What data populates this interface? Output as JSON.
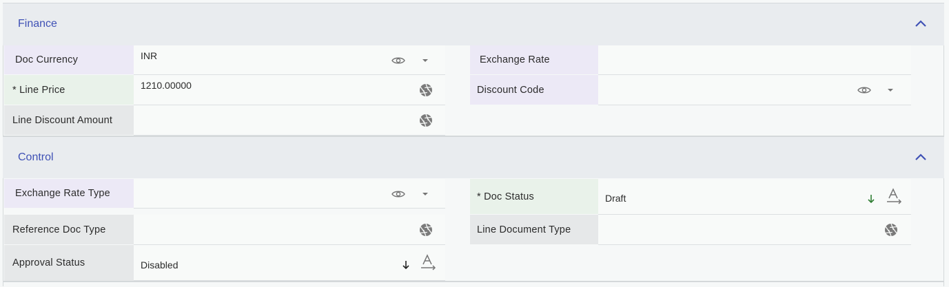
{
  "finance": {
    "title": "Finance",
    "doc_currency": {
      "label": "Doc Currency",
      "value": "INR"
    },
    "exchange_rate": {
      "label": "Exchange Rate",
      "value": ""
    },
    "line_price": {
      "label": "* Line Price",
      "value": "1210.00000"
    },
    "discount_code": {
      "label": "Discount Code",
      "value": ""
    },
    "line_discount_amount": {
      "label": "Line Discount Amount",
      "value": ""
    }
  },
  "control": {
    "title": "Control",
    "exchange_rate_type": {
      "label": "Exchange Rate Type",
      "value": ""
    },
    "doc_status": {
      "label": "* Doc Status",
      "value": "Draft"
    },
    "reference_doc_type": {
      "label": "Reference Doc Type",
      "value": ""
    },
    "line_document_type": {
      "label": "Line Document Type",
      "value": ""
    },
    "approval_status": {
      "label": "Approval Status",
      "value": "Disabled"
    }
  },
  "icons": {
    "eye": "eye-icon",
    "dropdown": "caret-down-icon",
    "aperture": "aperture-icon",
    "sort_down": "arrow-down-icon",
    "text_format": "text-format-icon",
    "collapse": "chevron-up-icon"
  },
  "colors": {
    "accent": "#3f51b5",
    "green_arrow": "#2e7d32"
  }
}
